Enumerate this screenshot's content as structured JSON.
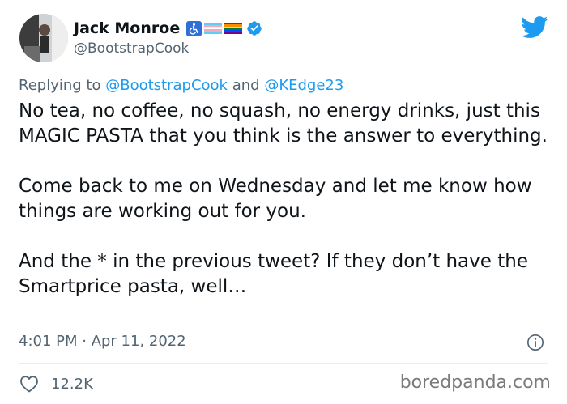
{
  "author": {
    "display_name": "Jack Monroe",
    "handle": "@BootstrapCook",
    "badges": [
      "accessibility-icon",
      "trans-flag-icon",
      "rainbow-flag-icon",
      "verified-icon"
    ]
  },
  "reply": {
    "prefix": "Replying to",
    "mention_1": "@BootstrapCook",
    "joiner": "and",
    "mention_2": "@KEdge23"
  },
  "tweet": {
    "paragraphs": [
      "No tea, no coffee, no squash, no energy drinks, just this MAGIC PASTA that you think is the answer to everything.",
      "Come back to me on Wednesday and let me know how things are working out for you.",
      "And the * in the previous tweet? If they don’t have the Smartprice pasta, well…"
    ],
    "timestamp": "4:01 PM · Apr 11, 2022"
  },
  "engagement": {
    "likes": "12.2K"
  },
  "watermark": "boredpanda.com",
  "colors": {
    "text": "#0f1419",
    "secondary": "#536471",
    "link": "#1d9bf0",
    "verified": "#1d9bf0",
    "twitter_brand": "#1d9bf0"
  }
}
